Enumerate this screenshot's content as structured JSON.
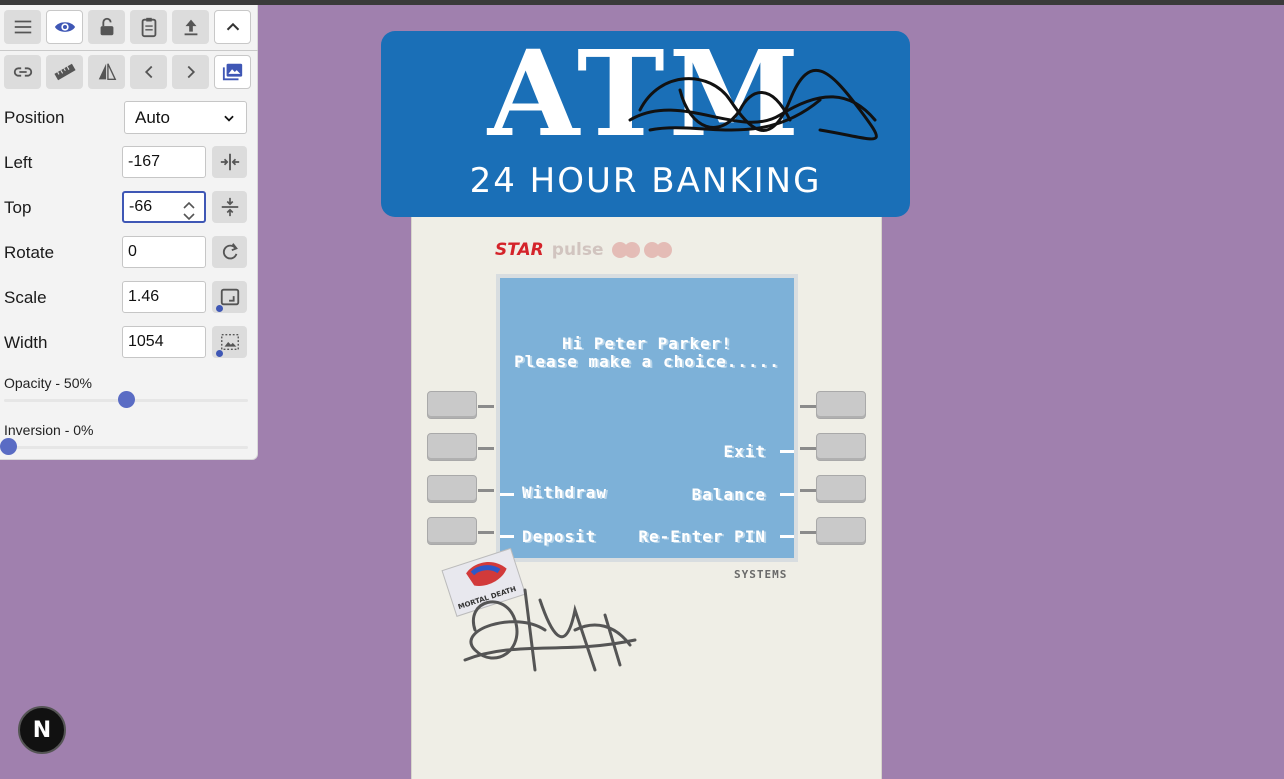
{
  "atm": {
    "sign_title": "ATM",
    "sign_subtitle": "24 HOUR BANKING",
    "logos": [
      "STAR",
      "pulse"
    ],
    "screen": {
      "greeting": "Hi Peter Parker!",
      "prompt": "Please make a choice.....",
      "right_options": [
        "Exit",
        "Balance",
        "Re-Enter PIN"
      ],
      "left_options": [
        "Withdraw",
        "Deposit"
      ]
    },
    "brand_footer": "SYSTEMS",
    "sticker_text": "MORTAL DEATH"
  },
  "panel": {
    "toolbar": {
      "row1": [
        "menu-icon",
        "eye-icon",
        "unlock-icon",
        "clipboard-icon",
        "upload-icon",
        "chevron-up-icon"
      ],
      "row2": [
        "link-icon",
        "ruler-icon",
        "flip-icon",
        "chevron-left-icon",
        "chevron-right-icon",
        "image-icon"
      ]
    },
    "position": {
      "label": "Position",
      "value": "Auto"
    },
    "left": {
      "label": "Left",
      "value": "-167"
    },
    "top": {
      "label": "Top",
      "value": "-66"
    },
    "rotate": {
      "label": "Rotate",
      "value": "0"
    },
    "scale": {
      "label": "Scale",
      "value": "1.46"
    },
    "width": {
      "label": "Width",
      "value": "1054"
    },
    "opacity": {
      "label": "Opacity - 50%",
      "value": 0.5
    },
    "inversion": {
      "label": "Inversion - 0%",
      "value": 0.0
    }
  },
  "dev_badge": "N",
  "colors": {
    "background": "#a080ae",
    "sign_blue": "#1a6fb7",
    "screen_blue": "#7db1d8",
    "accent": "#3f57b5"
  }
}
